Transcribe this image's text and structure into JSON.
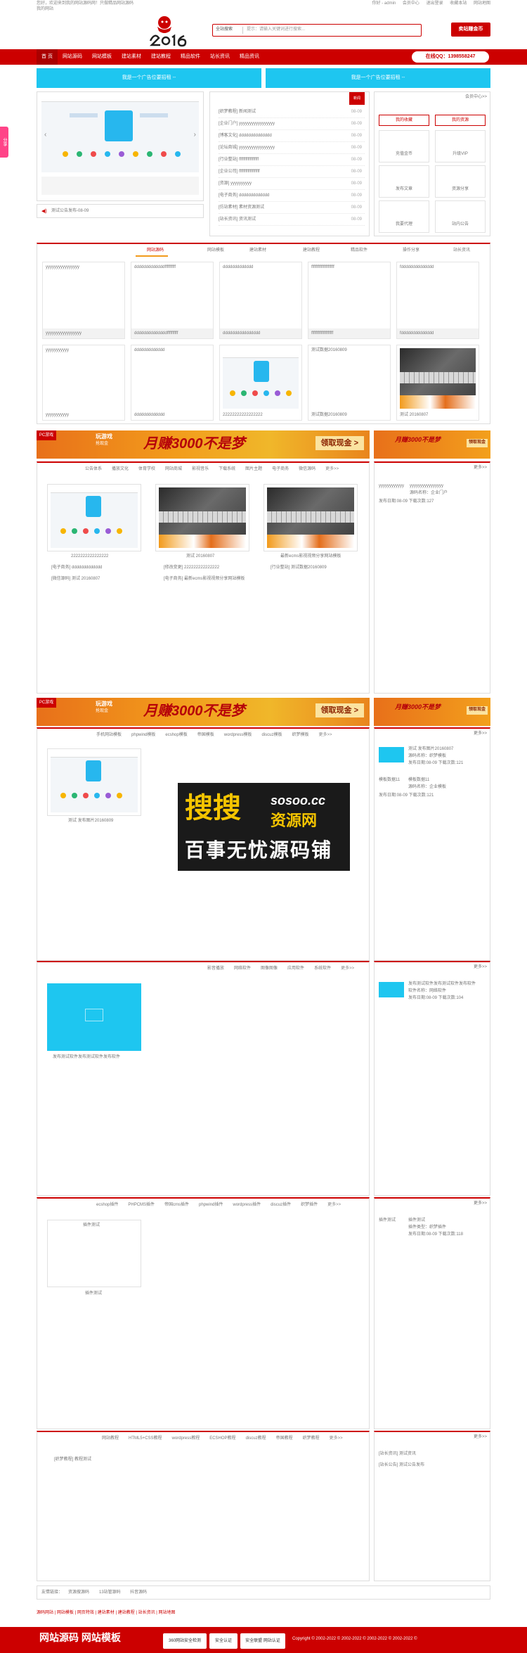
{
  "topbar": {
    "welcome": "您好，欢迎来到我的网站源码网！只做精品网站源码",
    "site": "我的网站",
    "links": [
      "你好 - admin",
      "会员中心",
      "退出登录",
      "收藏本站",
      "网站地图"
    ]
  },
  "search": {
    "category": "全站搜索",
    "placeholder": "提示：请输入关键词进行搜索..."
  },
  "buttons": {
    "deal": "卖站赚金币"
  },
  "nav": {
    "items": [
      "首 页",
      "网站源码",
      "网站模板",
      "建站素材",
      "建站教程",
      "精品软件",
      "站长资讯",
      "精品资讯"
    ],
    "qq": "在线QQ：1398558247"
  },
  "sidetab": "分享",
  "ads": {
    "left": "我是一个广告位要招租 --",
    "right": "我是一个广告位要招租 --"
  },
  "news": {
    "tag": "新闻",
    "items": [
      {
        "t": "[织梦教程] 新闻测试",
        "d": "08-09"
      },
      {
        "t": "[企业门户] yyyyyyyyyyyyyyyyy",
        "d": "08-09"
      },
      {
        "t": "[博客文化] dddddddddddddd",
        "d": "08-09"
      },
      {
        "t": "[论坛商城] yyyyyyyyyyyyyyyyy",
        "d": "08-09"
      },
      {
        "t": "[行业整站] ffffffffffffffffff",
        "d": "08-09"
      },
      {
        "t": "[企业公司] fffffffffffffffffff",
        "d": "08-09"
      },
      {
        "t": "[资源] yyyyyyyyyy",
        "d": "08-09"
      },
      {
        "t": "[电子商务] ddddddddddddd",
        "d": "08-09"
      },
      {
        "t": "[仿站素材] 素材资源测试",
        "d": "08-09"
      },
      {
        "t": "[站长资讯] 资讯测试",
        "d": "08-09"
      }
    ],
    "notice": "测试公告发布-08-09"
  },
  "user": {
    "more": "会员中心>>",
    "buttons": [
      "我的收藏",
      "我的资源"
    ],
    "cells": [
      "充值金币",
      "升级VIP",
      "发布文章",
      "资源分享",
      "我要代理",
      "站内公告"
    ]
  },
  "tabs1": [
    "网站源码",
    "网站模板",
    "建站素材",
    "建站教程",
    "精品软件",
    "操作分享",
    "站长资讯"
  ],
  "grid1": {
    "row1": [
      {
        "t": "yyyyyyyyyyyyyyyy",
        "b": "yyyyyyyyyyyyyyyyy"
      },
      {
        "t": "dddddddddddddffffffffff",
        "b": "ddddddddddddddffffffffff"
      },
      {
        "t": "ddddddddddddd",
        "b": "dddddddddddddddd"
      },
      {
        "t": "fffffffffffffffffffff",
        "b": "ffffffffffffffffffff"
      },
      {
        "t": "fdddddddddddddd",
        "b": "fdddddddddddddd"
      }
    ],
    "row2": [
      {
        "t": "yyyyyyyyyyy",
        "b": "yyyyyyyyyyy"
      },
      {
        "t": "ddddddddddddd",
        "b": "ddddddddddddd"
      },
      {
        "t": "",
        "b": "22222222222222222"
      },
      {
        "t": "测试数据20160809",
        "b": "测试数据20160809"
      },
      {
        "t": "",
        "b": "测试 20160807"
      }
    ]
  },
  "banner": {
    "tag": "PC游戏",
    "t1": "玩游戏",
    "t2": "抢现金",
    "t3": "月赚3000不是梦",
    "t4": "领取现金 >",
    "small": "月赚3000不是梦",
    "small_btn": "领取现金"
  },
  "sec1": {
    "tabs": [
      "公告体系",
      "播放文化",
      "体育学校",
      "网站商城",
      "影视音乐",
      "下载系统",
      "图片主题",
      "电子商务",
      "微信源码",
      "更多>>"
    ],
    "cards": [
      {
        "cap": "2222222222222222"
      },
      {
        "cap": "测试 20160807"
      },
      {
        "cap": "最新ecms影视视频分享网站模板"
      }
    ],
    "lines": [
      [
        "[电子商务] ddddddddddddd",
        "[修改变更] 222222222222222",
        "[行业整站] 测试数据20160809"
      ],
      [
        "[微信源码] 测试 20160807",
        "[电子商务] 最新ecms影视视频分享网站模板",
        ""
      ]
    ],
    "more": "更多>>",
    "side": {
      "title": "yyyyyyyyyyyy",
      "right": "yyyyyyyyyyyyyyyy",
      "l1": "源码名称：企业门户",
      "l2": "发布日期:08-09  下载次数:127"
    }
  },
  "sec2": {
    "tabs": [
      "手机网站模板",
      "phpwind模板",
      "ecshop模板",
      "帝国模板",
      "wordpress模板",
      "discuz模板",
      "织梦模板",
      "更多>>"
    ],
    "card": "测试 发布图片20160809",
    "side": [
      {
        "t": "测试 发布图片20160807",
        "l1": "源码名称：织梦模板",
        "l2": "发布日期:08-09  下载次数:121"
      },
      {
        "t": "模板数据11",
        "t2": "模板数据11",
        "l1": "源码名称：企业模板",
        "l2": "发布日期:08-09  下载次数:121"
      }
    ],
    "more": "更多>>"
  },
  "watermark": {
    "a": "搜搜",
    "b": "sosoo.cc",
    "c": "资源网",
    "d": "百事无忧源码铺"
  },
  "sec3": {
    "tabs": [
      "影音播放",
      "网络软件",
      "图像图像",
      "应用软件",
      "系统软件",
      "更多>>"
    ],
    "card": "发布测试软件发布测试软件发布软件",
    "side": {
      "t": "发布测试软件发布测试软件发布软件",
      "l1": "软件名称：网络软件",
      "l2": "发布日期:08-09  下载次数:104"
    },
    "more": "更多>>"
  },
  "sec4": {
    "tabs": [
      "ecshop插件",
      "PHPCMS插件",
      "帝国cms插件",
      "phpwind插件",
      "wordpress插件",
      "discuz插件",
      "织梦插件",
      "更多>>"
    ],
    "card_top": "插件测试",
    "card_cap": "插件测试",
    "side": {
      "t": "插件测试",
      "t2": "插件测试",
      "l1": "插件类型：织梦插件",
      "l2": "发布日期:08-09  下载次数:118"
    },
    "more": "更多>>"
  },
  "sec5": {
    "tabs": [
      "网站教程",
      "HTML5+CSS教程",
      "wordpress教程",
      "ECSHOP教程",
      "discuz教程",
      "帝国教程",
      "织梦教程",
      "更多>>"
    ],
    "line": "[织梦教程] 教程测试",
    "side": [
      "[站长资讯] 测试资讯",
      "[站长公告] 测试公告发布"
    ],
    "more": "更多>>"
  },
  "friendlinks": {
    "label": "友情链接：",
    "items": [
      "资源搜源码",
      "13站管源码",
      "抖音源码"
    ]
  },
  "footnav": [
    "源码网站",
    "网站模板",
    "网页特效",
    "建站素材",
    "建站教程",
    "站长资讯",
    "网站地图"
  ],
  "footer": {
    "name": "网站源码  网站模板",
    "badges": [
      "360网站安全检测",
      "安全认证",
      "安全联盟 网站认证"
    ],
    "copyright": "Copyright © 2002-2022 © 2002-2022 © 2002-2022 © 2002-2022 ©"
  }
}
